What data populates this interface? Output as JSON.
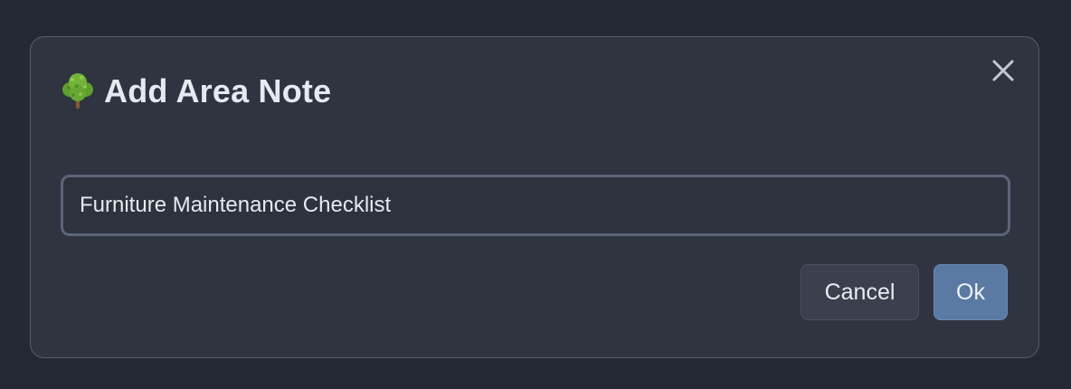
{
  "dialog": {
    "title": "Add Area Note",
    "title_icon": "tree-icon",
    "close_icon": "close-icon",
    "input_value": "Furniture Maintenance Checklist",
    "buttons": {
      "cancel_label": "Cancel",
      "ok_label": "Ok"
    }
  },
  "colors": {
    "background": "#242832",
    "dialog": "#2f3440",
    "primary_button": "#5a7aa3",
    "secondary_button": "#3a404d"
  }
}
